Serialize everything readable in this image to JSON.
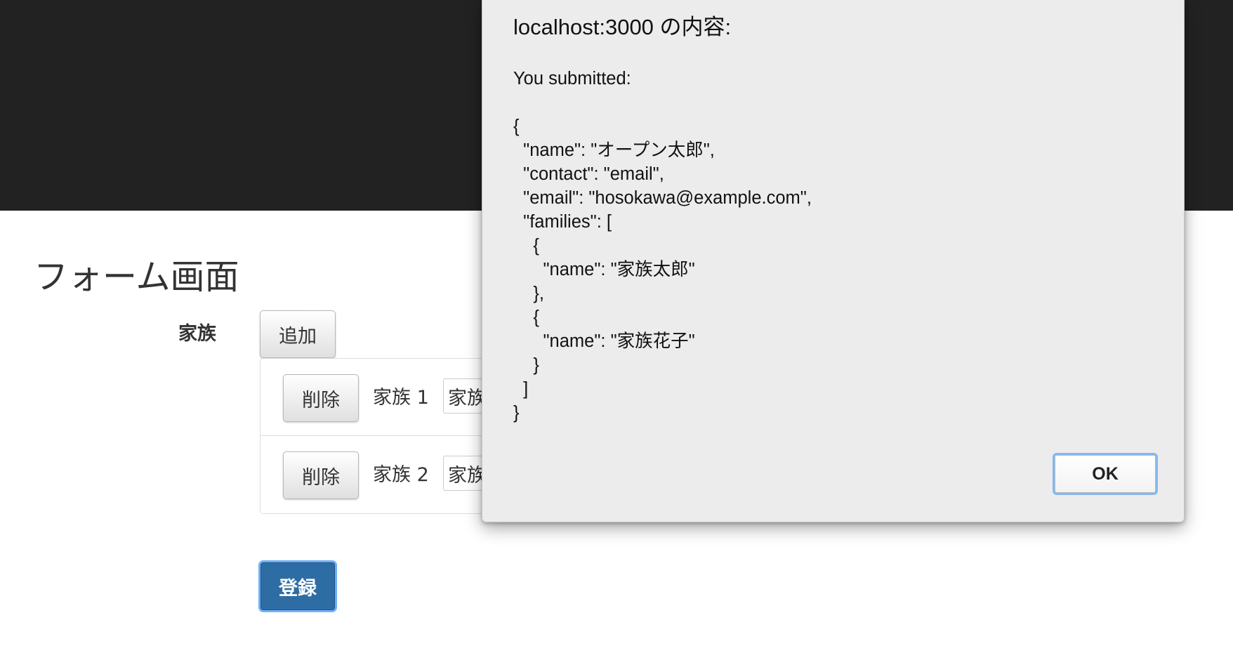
{
  "page": {
    "title": "フォーム画面"
  },
  "form": {
    "families_label": "家族",
    "add_label": "追加",
    "families": [
      {
        "delete_label": "削除",
        "label": "家族 1",
        "value": "家族太郎"
      },
      {
        "delete_label": "削除",
        "label": "家族 2",
        "value": "家族花子"
      }
    ],
    "submit_label": "登録"
  },
  "alert": {
    "title": "localhost:3000 の内容:",
    "message": "You submitted:\n\n{\n  \"name\": \"オープン太郎\",\n  \"contact\": \"email\",\n  \"email\": \"hosokawa@example.com\",\n  \"families\": [\n    {\n      \"name\": \"家族太郎\"\n    },\n    {\n      \"name\": \"家族花子\"\n    }\n  ]\n}",
    "ok_label": "OK"
  },
  "colors": {
    "header_bg": "#222222",
    "primary": "#2e6da4",
    "focus_ring": "#6fb1f5",
    "dialog_bg": "#ececec"
  }
}
